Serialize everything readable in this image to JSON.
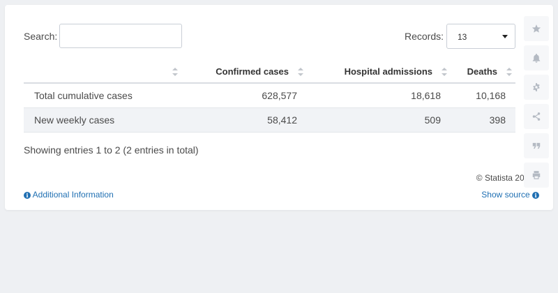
{
  "search": {
    "label": "Search:",
    "value": "",
    "placeholder": ""
  },
  "records": {
    "label": "Records:",
    "value": "13"
  },
  "table": {
    "headers": [
      "",
      "Confirmed cases",
      "Hospital admissions",
      "Deaths"
    ],
    "rows": [
      [
        "Total cumulative cases",
        "628,577",
        "18,618",
        "10,168"
      ],
      [
        "New weekly cases",
        "58,412",
        "509",
        "398"
      ]
    ]
  },
  "footer": {
    "showing": "Showing entries 1 to 2 (2 entries in total)",
    "copyright": "© Statista 2021",
    "additional_info": "Additional Information",
    "show_source": "Show source"
  },
  "toolbar": {
    "icons": [
      "star-icon",
      "bell-icon",
      "gear-icon",
      "share-icon",
      "quote-icon",
      "print-icon"
    ]
  },
  "colors": {
    "link": "#1f6fb2",
    "alt_row": "#f1f3f6"
  }
}
